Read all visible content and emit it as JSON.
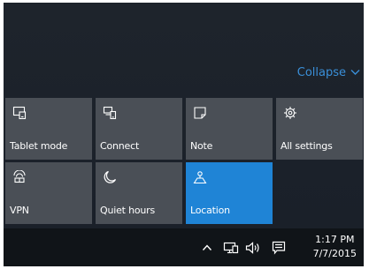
{
  "action_center": {
    "collapse_label": "Collapse",
    "collapse_icon": "chevron-down-icon",
    "accent_color": "#1f84d6",
    "tile_color": "#4a4f56",
    "tiles": [
      {
        "label": "Tablet mode",
        "icon": "tablet-mode-icon",
        "active": false
      },
      {
        "label": "Connect",
        "icon": "connect-icon",
        "active": false
      },
      {
        "label": "Note",
        "icon": "note-icon",
        "active": false
      },
      {
        "label": "All settings",
        "icon": "gear-icon",
        "active": false
      },
      {
        "label": "VPN",
        "icon": "vpn-icon",
        "active": false
      },
      {
        "label": "Quiet hours",
        "icon": "moon-icon",
        "active": false
      },
      {
        "label": "Location",
        "icon": "location-icon",
        "active": true
      }
    ]
  },
  "taskbar": {
    "tray_icons": [
      "chevron-up-icon",
      "network-icon",
      "volume-icon",
      "action-center-icon"
    ],
    "time": "1:17 PM",
    "date": "7/7/2015"
  }
}
